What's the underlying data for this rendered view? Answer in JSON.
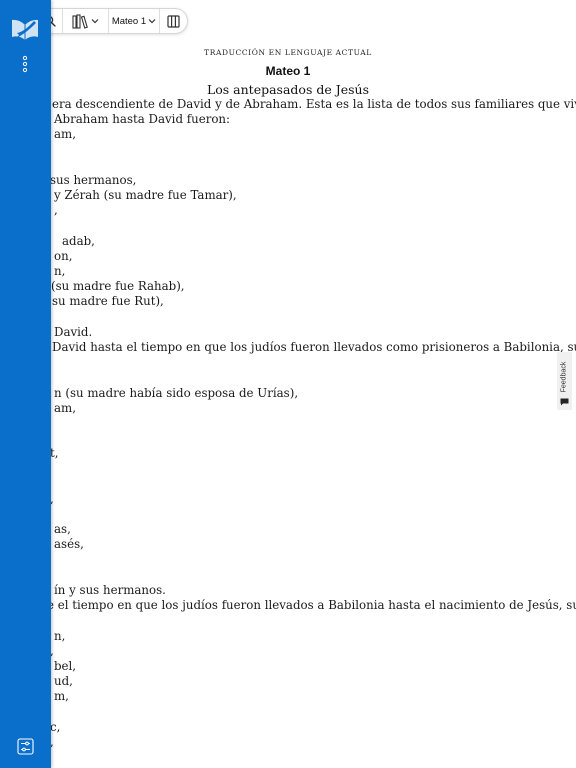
{
  "toolbar": {
    "book_label": "Mateo 1"
  },
  "page": {
    "version_name": "Traducción en lenguaje actual",
    "chapter_title": "Mateo 1",
    "section_heading": "Los antepasados de Jesús",
    "lines": [
      "era descendiente de David y de Abraham. Esta es la lista de todos sus familiares que vivieron antes de él:",
      "Abraham hasta David fueron:",
      "am,",
      "",
      "",
      "sus hermanos,",
      "y Zérah (su madre fue Tamar),",
      ",",
      "",
      "adab,",
      "on,",
      "n,",
      "(su madre fue Rahab),",
      "su madre fue Rut),",
      "",
      "David.",
      "David hasta el tiempo en que los judíos fueron llevados como prisioneros a Babilonia, sus antepasados",
      "",
      "",
      "n (su madre había sido esposa de Urías),",
      "am,",
      "",
      "",
      "t,",
      "",
      "",
      ",",
      "",
      "as,",
      "asés,",
      "",
      "",
      "ín y sus hermanos.",
      "e el tiempo en que los judíos fueron llevados a Babilonia hasta el nacimiento de Jesús, sus antepasados",
      "",
      "n,",
      ",",
      "bel,",
      "ud,",
      "m,",
      "",
      "c,",
      ","
    ],
    "line_offsets": [
      13,
      52,
      52,
      52,
      52,
      48,
      52,
      52,
      52,
      60,
      52,
      52,
      49,
      50,
      52,
      52,
      50,
      52,
      52,
      52,
      52,
      52,
      52,
      48,
      52,
      52,
      48,
      52,
      52,
      52,
      52,
      52,
      52,
      45,
      52,
      52,
      48,
      52,
      52,
      52,
      52,
      48,
      48
    ]
  },
  "feedback": {
    "label": "Feedback"
  },
  "colors": {
    "sidebar": "#0a6ecb",
    "text": "#1a1a1a"
  }
}
